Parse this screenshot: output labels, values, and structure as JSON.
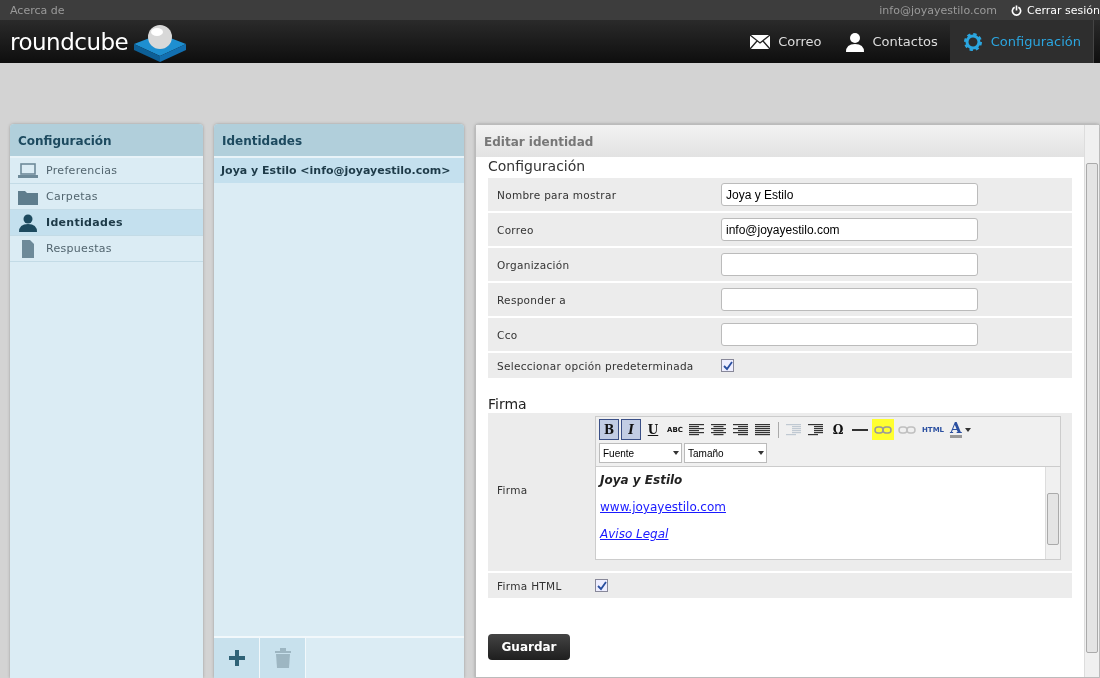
{
  "topbar": {
    "about": "Acerca de",
    "user": "info@joyayestilo.com",
    "logout": "Cerrar sesión"
  },
  "logo": "roundcube",
  "nav": [
    {
      "label": "Correo",
      "kind": "mail",
      "selected": false
    },
    {
      "label": "Contactos",
      "kind": "person",
      "selected": false
    },
    {
      "label": "Configuración",
      "kind": "gear",
      "selected": true
    }
  ],
  "sidebar": {
    "title": "Configuración",
    "items": [
      {
        "label": "Preferencias",
        "kind": "laptop",
        "selected": false
      },
      {
        "label": "Carpetas",
        "kind": "folder",
        "selected": false
      },
      {
        "label": "Identidades",
        "kind": "person",
        "selected": true
      },
      {
        "label": "Respuestas",
        "kind": "doc",
        "selected": false
      }
    ]
  },
  "identities": {
    "title": "Identidades",
    "items": [
      {
        "label": "Joya y Estilo <info@joyayestilo.com>",
        "selected": true
      }
    ]
  },
  "editor": {
    "title": "Editar identidad",
    "section": "Configuración",
    "fields": [
      {
        "label": "Nombre para mostrar",
        "kind": "text",
        "value": "Joya y Estilo"
      },
      {
        "label": "Correo",
        "kind": "text",
        "value": "info@joyayestilo.com"
      },
      {
        "label": "Organización",
        "kind": "text"
      },
      {
        "label": "Responder a",
        "kind": "text"
      },
      {
        "label": "Cco",
        "kind": "text"
      },
      {
        "label": "Seleccionar opción predeterminada",
        "kind": "checkbox",
        "checked": true
      }
    ],
    "signature_section": "Firma",
    "signature_label": "Firma",
    "toolbar": [
      {
        "kind": "char",
        "label": "B",
        "selected": true,
        "disabled": false,
        "highlighted": false
      },
      {
        "kind": "char",
        "label": "I",
        "selected": true,
        "disabled": false,
        "highlighted": false
      },
      {
        "kind": "char",
        "label": "U",
        "selected": false,
        "disabled": false,
        "highlighted": false
      },
      {
        "kind": "char",
        "label": "ABC",
        "selected": false,
        "disabled": false,
        "highlighted": false
      },
      {
        "kind": "align-left",
        "selected": false,
        "disabled": false,
        "highlighted": false
      },
      {
        "kind": "align-center",
        "selected": false,
        "disabled": false,
        "highlighted": false
      },
      {
        "kind": "align-right",
        "selected": false,
        "disabled": false,
        "highlighted": false
      },
      {
        "kind": "justify",
        "selected": false,
        "disabled": false,
        "highlighted": false
      },
      {
        "kind": "sep"
      },
      {
        "kind": "outdent",
        "selected": false,
        "disabled": true,
        "highlighted": false
      },
      {
        "kind": "indent",
        "selected": false,
        "disabled": false,
        "highlighted": false
      },
      {
        "kind": "char",
        "label": "Ω",
        "selected": false,
        "disabled": false,
        "highlighted": false
      },
      {
        "kind": "hr",
        "selected": false,
        "disabled": false,
        "highlighted": false
      },
      {
        "kind": "link",
        "selected": false,
        "disabled": true,
        "highlighted": true
      },
      {
        "kind": "unlink",
        "selected": false,
        "disabled": true,
        "highlighted": false
      },
      {
        "kind": "char",
        "label": "HTML",
        "selected": false,
        "disabled": false,
        "highlighted": false
      },
      {
        "kind": "color",
        "label": "A",
        "selected": false,
        "disabled": false,
        "highlighted": false
      }
    ],
    "font_select": "Fuente",
    "size_select": "Tamaño",
    "signature_lines": [
      {
        "kind": "bolditalic",
        "text": "Joya y Estilo"
      },
      {
        "kind": "link",
        "text": "www.joyayestilo.com"
      },
      {
        "kind": "italiclink",
        "text": "Aviso Legal"
      }
    ],
    "html_label": "Firma HTML",
    "html_checked": true,
    "save": "Guardar"
  }
}
